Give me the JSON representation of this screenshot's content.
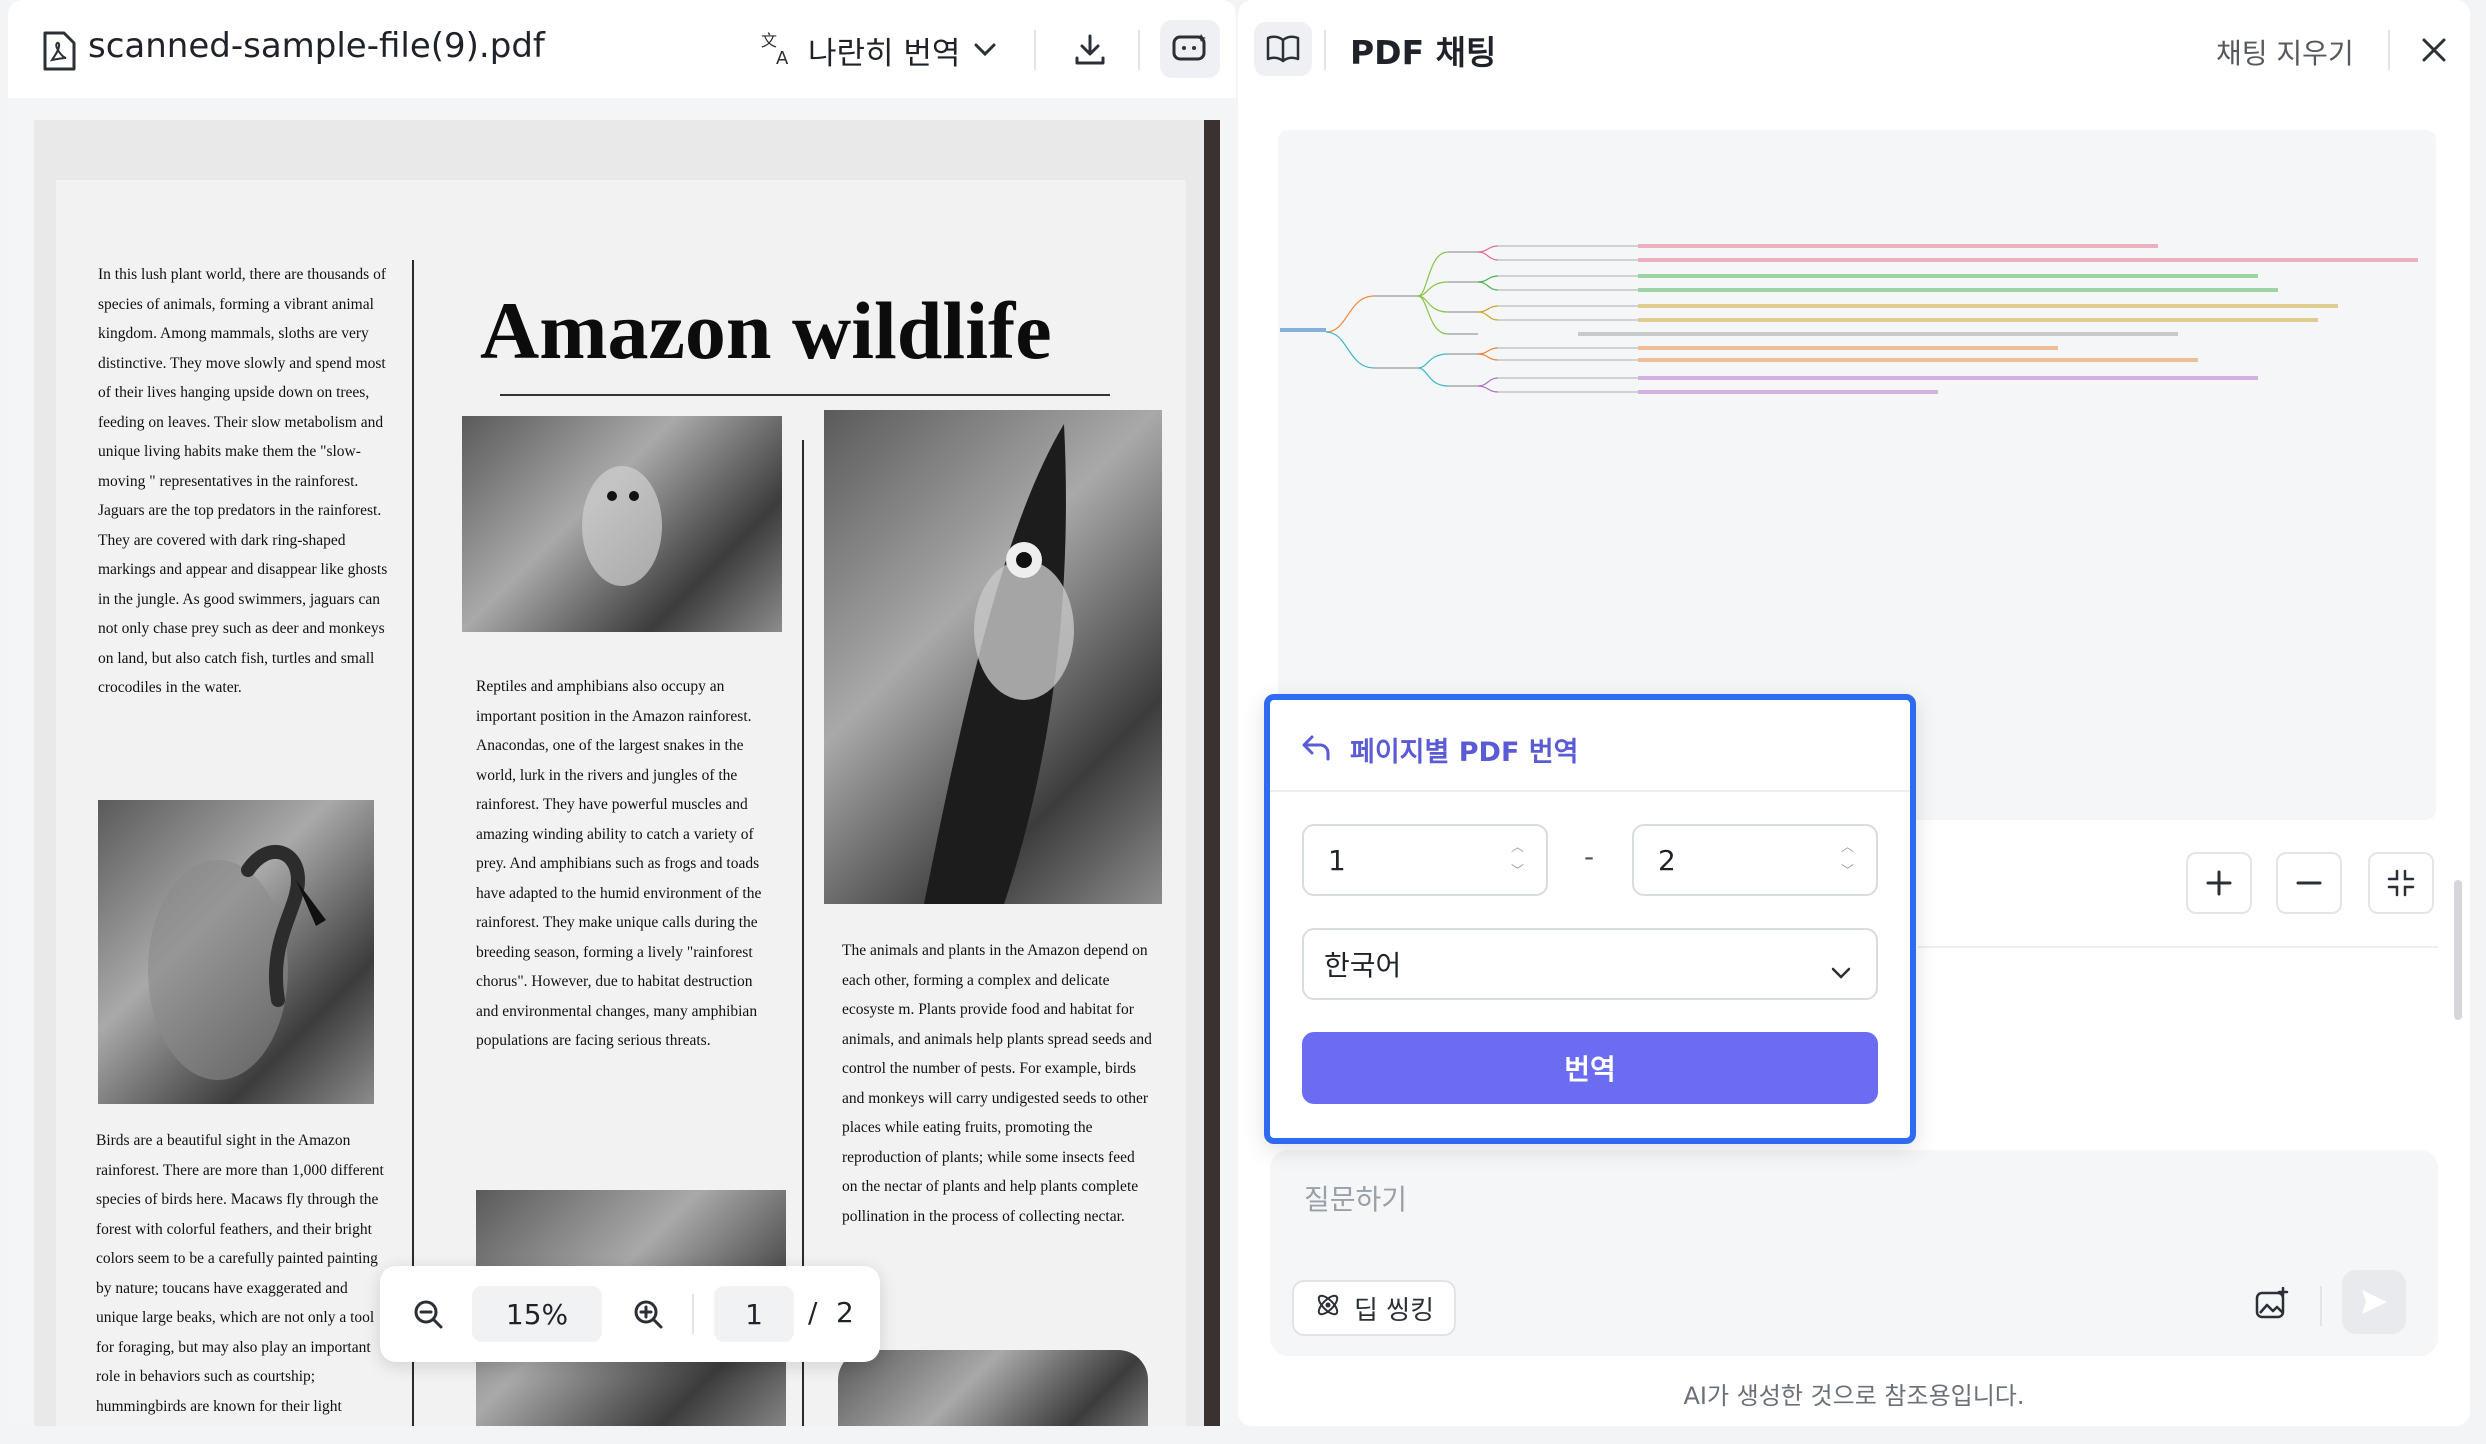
{
  "viewer": {
    "file_name": "scanned-sample-file(9).pdf",
    "translate_mode": "나란히 번역",
    "zoom": "15%",
    "current_page": "1",
    "page_sep": "/",
    "total_pages": "2"
  },
  "document": {
    "title": "Amazon wildlife",
    "col1_para1": "In this lush plant world, there are thousands of species of animals, forming a vibrant animal kingdom. Among mammals, sloths are very distinctive. They move slowly and spend most of their lives hanging upside down on trees, feeding on leaves. Their slow metabolism and unique living habits make them the \"slow-moving \" representatives in the rainforest. Jaguars are the top predators in the rainforest. They are covered with dark ring-shaped markings and appear and disappear like ghosts in the jungle. As good swimmers, jaguars can not only chase prey such as deer and monkeys on land, but also catch fish, turtles and small crocodiles in the water.",
    "col1_para2": "Birds are a beautiful sight in the Amazon rainforest. There are more than 1,000 different species of birds here. Macaws fly through the forest with colorful feathers, and their bright colors seem to be a carefully painted painting by nature; toucans have exaggerated and unique large beaks, which are not only a tool for foraging, but may also play an important role in behaviors such as courtship; hummingbirds are known for their light posture and fast-beating wings. They can",
    "col2_para1": "Reptiles and amphibians also occupy an important position in the Amazon rainforest. Anacondas, one of the largest snakes in the world, lurk in the rivers and jungles of the rainforest. They have powerful muscles and amazing winding ability to catch a variety of prey. And amphibians such as frogs and toads have adapted to the humid environment of the rainforest. They make unique calls during the breeding season, forming a lively \"rainforest chorus\". However, due to habitat destruction and environmental changes, many amphibian populations are facing serious threats.",
    "col3_para1": "The animals and plants in the Amazon depend on each other, forming a complex and delicate ecosyste m. Plants provide food and habitat for animals, and animals help plants spread seeds and control the number of pests. For example, birds and monkeys will carry undigested seeds to other places while eating fruits, promoting the reproduction of plants; while some insects feed on the nectar of plants and help plants complete pollination in the process of collecting nectar."
  },
  "chat": {
    "title": "PDF 채팅",
    "clear_label": "채팅 지우기",
    "ask_placeholder": "질문하기",
    "deep_thinking_label": "딥 씽킹",
    "footnote": "AI가 생성한 것으로 참조용입니다."
  },
  "popup": {
    "title": "페이지별 PDF 번역",
    "from_page": "1",
    "range_sep": "-",
    "to_page": "2",
    "language": "한국어",
    "translate_button": "번역"
  },
  "colors": {
    "accent": "#6c6cf2",
    "popup_border": "#2f6bf0",
    "popup_title": "#5b5bd6"
  }
}
